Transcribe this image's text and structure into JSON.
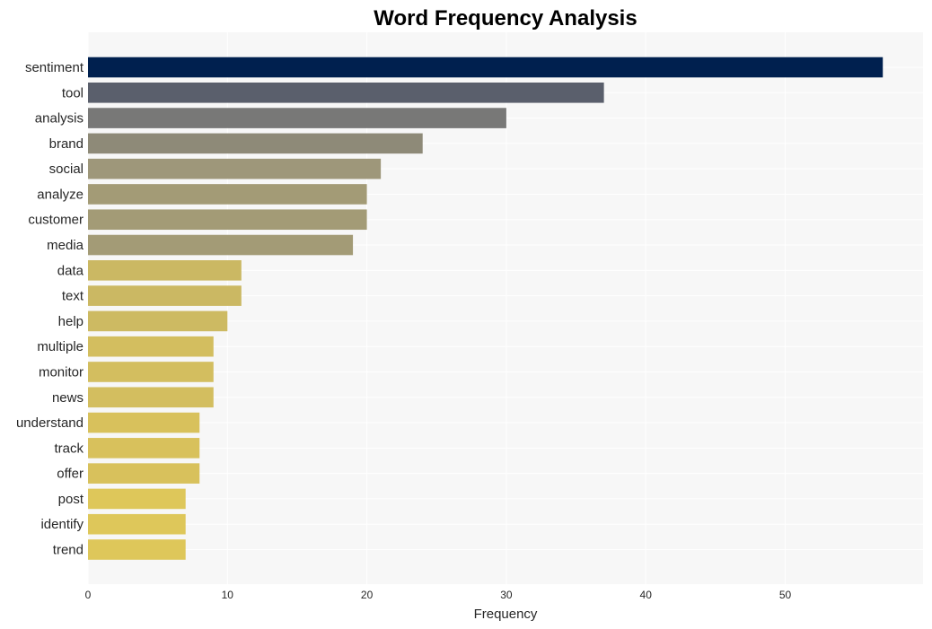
{
  "chart_data": {
    "type": "bar",
    "orientation": "horizontal",
    "title": "Word Frequency Analysis",
    "xlabel": "Frequency",
    "ylabel": "",
    "xlim": [
      0,
      60
    ],
    "xticks": [
      0,
      10,
      20,
      30,
      40,
      50
    ],
    "grid": true,
    "legend": null,
    "categories": [
      "sentiment",
      "tool",
      "analysis",
      "brand",
      "social",
      "analyze",
      "customer",
      "media",
      "data",
      "text",
      "help",
      "multiple",
      "monitor",
      "news",
      "understand",
      "track",
      "offer",
      "post",
      "identify",
      "trend"
    ],
    "values": [
      57,
      37,
      30,
      24,
      21,
      20,
      20,
      19,
      11,
      11,
      10,
      9,
      9,
      9,
      8,
      8,
      8,
      7,
      7,
      7
    ],
    "colors": [
      "#00204f",
      "#5a5f6c",
      "#787877",
      "#8e8a78",
      "#9e977a",
      "#a39b76",
      "#a39b76",
      "#a39b76",
      "#cbb863",
      "#cbb863",
      "#cdba62",
      "#d3be5f",
      "#d3be5f",
      "#d3be5f",
      "#d8c15c",
      "#d8c15c",
      "#d8c15c",
      "#dec75a",
      "#dec75a",
      "#dec75a"
    ]
  }
}
